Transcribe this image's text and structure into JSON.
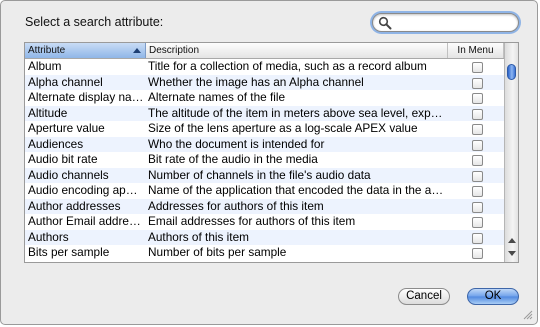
{
  "dialog": {
    "prompt": "Select a search attribute:",
    "search": {
      "value": "",
      "icon": "search-icon"
    }
  },
  "table": {
    "columns": {
      "attribute": "Attribute",
      "description": "Description",
      "in_menu": "In Menu"
    },
    "sort": "ascending",
    "rows": [
      {
        "name": "Album",
        "description": "Title for a collection of media, such as a record album",
        "in_menu": false
      },
      {
        "name": "Alpha channel",
        "description": "Whether the image has an Alpha channel",
        "in_menu": false
      },
      {
        "name": "Alternate display na…",
        "description": "Alternate names of the file",
        "in_menu": false
      },
      {
        "name": "Altitude",
        "description": "The altitude of the item in meters above sea level, expre…",
        "in_menu": false
      },
      {
        "name": "Aperture value",
        "description": "Size of the lens aperture as a log-scale APEX value",
        "in_menu": false
      },
      {
        "name": "Audiences",
        "description": "Who the document is intended for",
        "in_menu": false
      },
      {
        "name": "Audio bit rate",
        "description": "Bit rate of the audio in the media",
        "in_menu": false
      },
      {
        "name": "Audio channels",
        "description": "Number of channels in the file's audio data",
        "in_menu": false
      },
      {
        "name": "Audio encoding appl…",
        "description": "Name of the application that encoded the data in the au…",
        "in_menu": false
      },
      {
        "name": "Author addresses",
        "description": "Addresses for authors of this item",
        "in_menu": false
      },
      {
        "name": "Author Email addresses",
        "description": "Email addresses for authors of this item",
        "in_menu": false
      },
      {
        "name": "Authors",
        "description": "Authors of this item",
        "in_menu": false
      },
      {
        "name": "Bits per sample",
        "description": "Number of bits per sample",
        "in_menu": false
      }
    ]
  },
  "buttons": {
    "cancel": "Cancel",
    "ok": "OK"
  },
  "colors": {
    "accent": "#6fa1ea",
    "stripe": "#edf3fe",
    "header_sorted": "#8fb6e8"
  }
}
